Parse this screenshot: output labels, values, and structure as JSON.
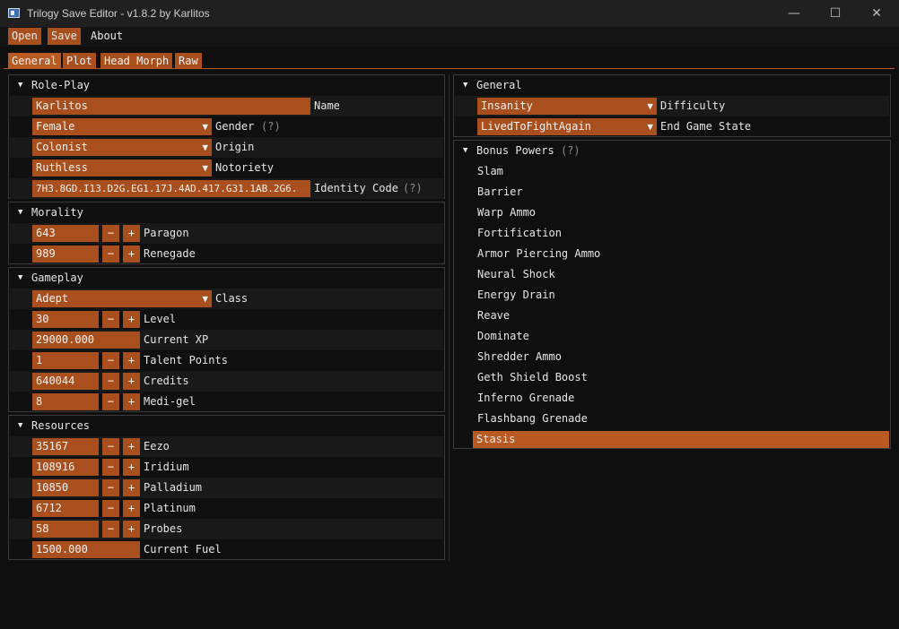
{
  "window": {
    "title": "Trilogy Save Editor - v1.8.2 by Karlitos",
    "minimize": "—",
    "maximize": "☐",
    "close": "✕"
  },
  "menu": {
    "open": "Open",
    "save": "Save",
    "about": "About"
  },
  "tabs": {
    "general": "General",
    "plot": "Plot",
    "head_morph": "Head Morph",
    "raw": "Raw"
  },
  "roleplay": {
    "title": "Role-Play",
    "name_value": "Karlitos",
    "name_label": "Name",
    "gender_value": "Female",
    "gender_label": "Gender",
    "origin_value": "Colonist",
    "origin_label": "Origin",
    "notoriety_value": "Ruthless",
    "notoriety_label": "Notoriety",
    "identity_value": "7H3.8GD.I13.D2G.EG1.17J.4AD.417.G31.1AB.2G6.",
    "identity_label": "Identity Code",
    "help": "(?)"
  },
  "morality": {
    "title": "Morality",
    "paragon_value": "643",
    "paragon_label": "Paragon",
    "renegade_value": "989",
    "renegade_label": "Renegade"
  },
  "gameplay": {
    "title": "Gameplay",
    "class_value": "Adept",
    "class_label": "Class",
    "level_value": "30",
    "level_label": "Level",
    "xp_value": "29000.000",
    "xp_label": "Current XP",
    "talent_value": "1",
    "talent_label": "Talent Points",
    "credits_value": "640044",
    "credits_label": "Credits",
    "medigel_value": "8",
    "medigel_label": "Medi-gel"
  },
  "resources": {
    "title": "Resources",
    "eezo_value": "35167",
    "eezo_label": "Eezo",
    "iridium_value": "108916",
    "iridium_label": "Iridium",
    "palladium_value": "10850",
    "palladium_label": "Palladium",
    "platinum_value": "6712",
    "platinum_label": "Platinum",
    "probes_value": "58",
    "probes_label": "Probes",
    "fuel_value": "1500.000",
    "fuel_label": "Current Fuel"
  },
  "general": {
    "title": "General",
    "difficulty_value": "Insanity",
    "difficulty_label": "Difficulty",
    "endgame_value": "LivedToFightAgain",
    "endgame_label": "End Game State"
  },
  "bonus_powers": {
    "title": "Bonus Powers",
    "help": "(?)",
    "items": [
      "Slam",
      "Barrier",
      "Warp Ammo",
      "Fortification",
      "Armor Piercing Ammo",
      "Neural Shock",
      "Energy Drain",
      "Reave",
      "Dominate",
      "Shredder Ammo",
      "Geth Shield Boost",
      "Inferno Grenade",
      "Flashbang Grenade",
      "Stasis"
    ],
    "selected": "Stasis"
  },
  "controls": {
    "minus": "−",
    "plus": "+",
    "expanded": "▼",
    "dropdown": "▼"
  },
  "colors": {
    "accent": "#a84f1d",
    "accent_active": "#b95a22",
    "background": "#0f0f0f",
    "panel_border": "#3a3a3a",
    "titlebar": "#202020"
  }
}
